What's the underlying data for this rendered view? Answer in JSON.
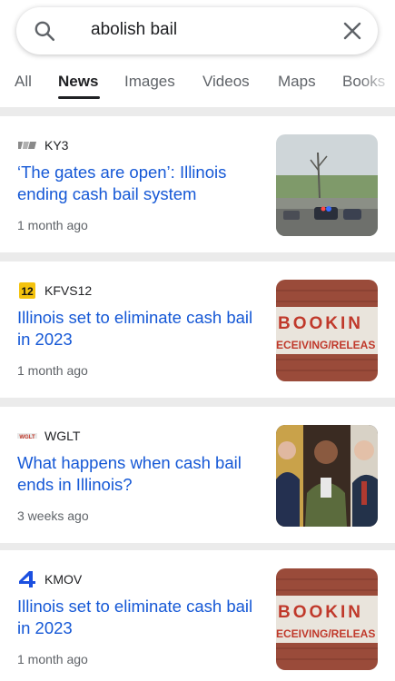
{
  "search": {
    "query": "abolish bail"
  },
  "tabs": [
    "All",
    "News",
    "Images",
    "Videos",
    "Maps",
    "Books"
  ],
  "active_tab": "News",
  "articles": [
    {
      "source": "KY3",
      "logo": "ky3-logo",
      "headline": "‘The gates are open’: Illinois ending cash bail system",
      "age": "1 month ago",
      "thumb": "police-street-thumbnail"
    },
    {
      "source": "KFVS12",
      "logo": "kfvs12-logo",
      "headline": "Illinois set to eliminate cash bail in 2023",
      "age": "1 month ago",
      "thumb": "booking-sign-thumbnail",
      "thumb_text": [
        "BOOKIN",
        "ECEIVING/RELEAS"
      ]
    },
    {
      "source": "WGLT",
      "logo": "wglt-logo",
      "headline": "What happens when cash bail ends in Illinois?",
      "age": "3 weeks ago",
      "thumb": "three-men-thumbnail"
    },
    {
      "source": "KMOV",
      "logo": "kmov-logo",
      "headline": "Illinois set to eliminate cash bail in 2023",
      "age": "1 month ago",
      "thumb": "booking-sign-thumbnail",
      "thumb_text": [
        "BOOKIN",
        "ECEIVING/RELEAS"
      ]
    }
  ],
  "colors": {
    "link": "#1558d6",
    "gutter": "#ebebeb",
    "kmov_blue": "#1a4fe0",
    "kfvs_yellow": "#f4c20d"
  }
}
